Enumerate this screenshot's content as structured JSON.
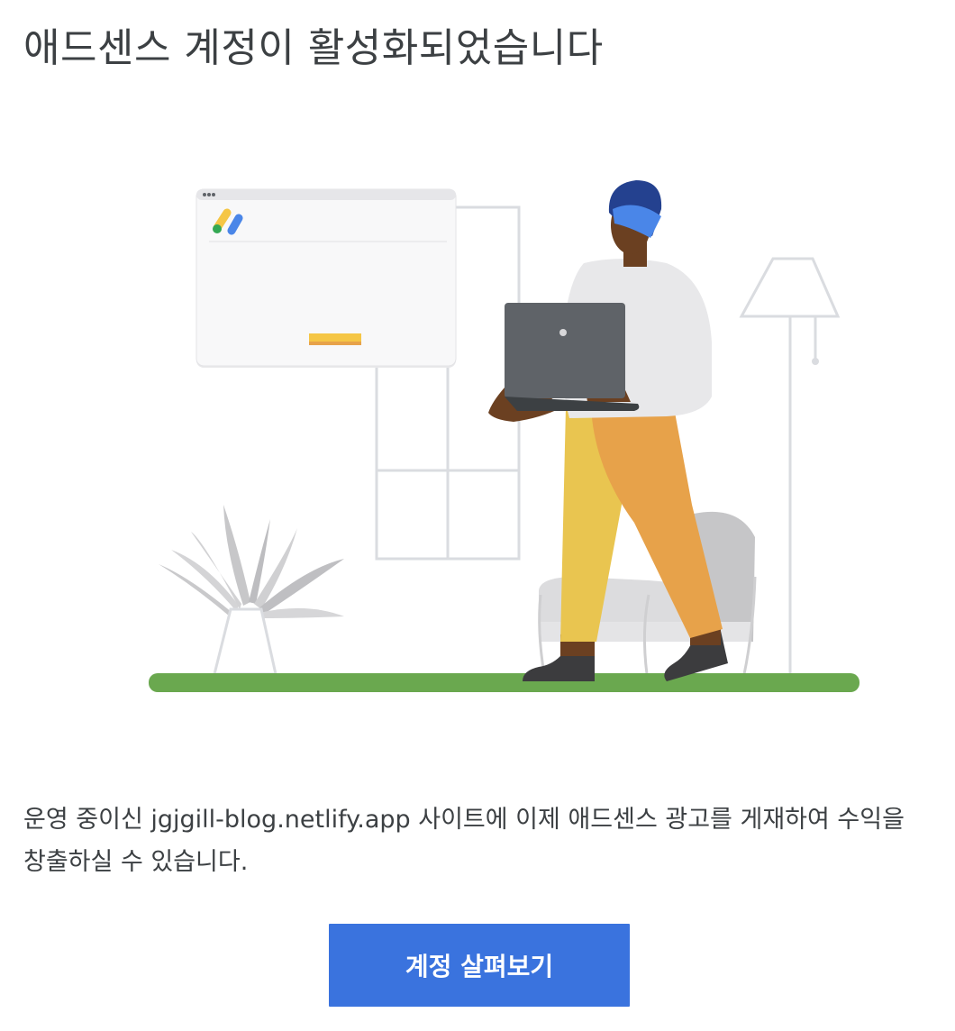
{
  "header": {
    "title": "애드센스 계정이 활성화되었습니다"
  },
  "illustration": {
    "colors": {
      "grass": "#6aa84f",
      "laptop": "#5f6368",
      "pants_left": "#e9c550",
      "pants_right": "#e7a24a",
      "hat": "#4a86e8",
      "skin": "#6b4021",
      "ad_bar": "#f5c645"
    },
    "icons": [
      "adsense-logo-icon",
      "window-dots-icon"
    ]
  },
  "message": {
    "text": "운영 중이신 jgjgill-blog.netlify.app 사이트에 이제 애드센스 광고를 게재하여 수익을 창출하실 수 있습니다."
  },
  "cta": {
    "label": "계정 살펴보기",
    "color": "#3a73de"
  }
}
